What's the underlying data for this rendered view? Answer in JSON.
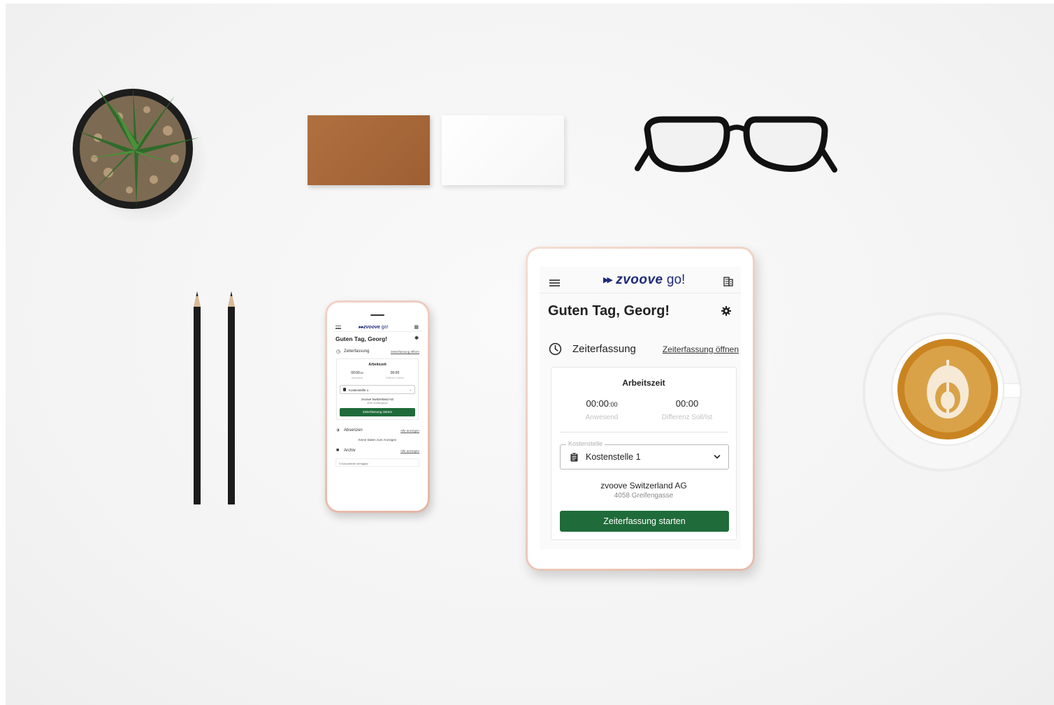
{
  "tablet": {
    "logo_brand": "zvoove",
    "logo_suffix": "go!",
    "greeting": "Guten Tag, Georg!",
    "section_title": "Zeiterfassung",
    "section_link": "Zeiterfassung öffnen",
    "card_title": "Arbeitszeit",
    "present_time": "00:00",
    "present_seconds": ":00",
    "present_label": "Anwesend",
    "diff_time": "00:00",
    "diff_label": "Differenz Soll/Ist",
    "cost_center_legend": "Kostenstelle",
    "cost_center_value": "Kostenstelle 1",
    "company_name": "zvoove Switzerland AG",
    "company_address": "4058 Greifengasse",
    "start_button": "Zeiterfassung starten"
  },
  "phone": {
    "logo_brand": "zvoove",
    "logo_suffix": "go!",
    "greeting": "Guten Tag, Georg!",
    "section_title": "Zeiterfassung",
    "section_link": "Zeiterfassung öffnen",
    "card_title": "Arbeitszeit",
    "present_time": "00:00",
    "present_seconds": ":00",
    "present_label": "Anwesend",
    "diff_time": "00:00",
    "diff_label": "Differenz Soll/Ist",
    "cost_center_value": "Kostenstelle 1",
    "company_name": "zvoove Switzerland AG",
    "company_address": "4058 Greifengasse",
    "start_button": "Zeiterfassung starten",
    "absences_title": "Absenzen",
    "absences_link": "Alle anzeigen",
    "absences_empty": "Keine Daten zum Anzeigen",
    "archive_title": "Archiv",
    "archive_link": "Alle anzeigen",
    "archive_docs": "3 Dokumente verfügbar"
  },
  "colors": {
    "brand": "#1e2a7a",
    "primary_button": "#1f6b3a"
  },
  "icons": [
    "menu-icon",
    "building-icon",
    "gear-icon",
    "clock-icon",
    "clipboard-icon",
    "chevron-down-icon",
    "airplane-icon",
    "archive-icon"
  ]
}
